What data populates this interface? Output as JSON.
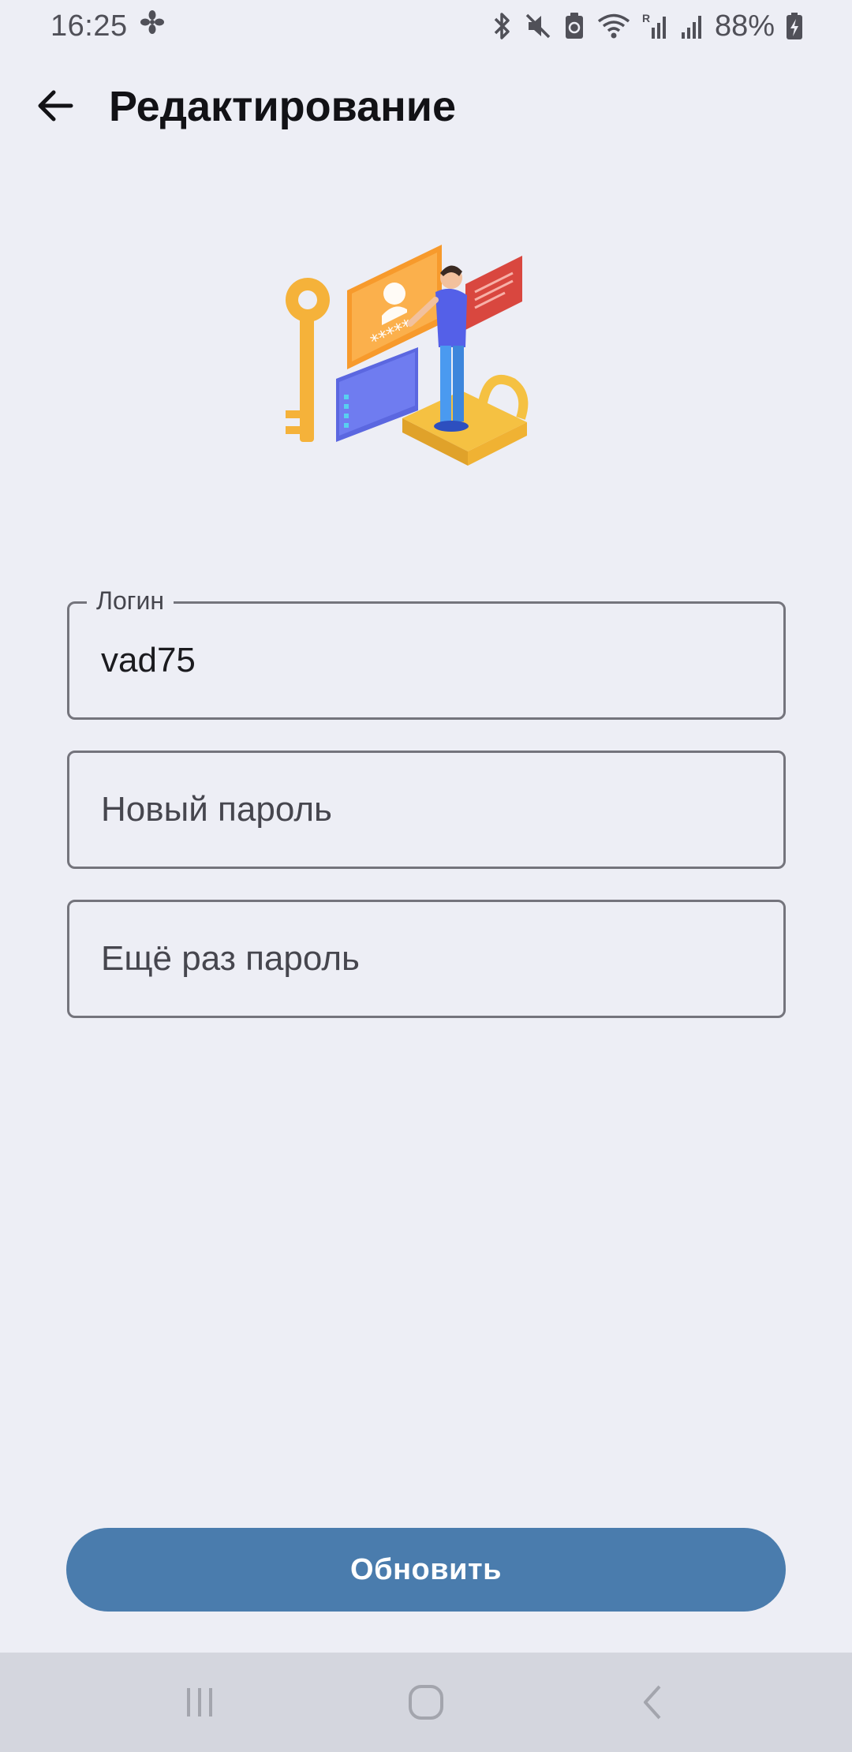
{
  "status_bar": {
    "time": "16:25",
    "battery": "88%",
    "icons": [
      "fan-icon",
      "bluetooth-icon",
      "mute-icon",
      "recycle-icon",
      "wifi-icon",
      "signal-roaming-icon",
      "signal-icon",
      "battery-charging-icon"
    ]
  },
  "app_bar": {
    "back_icon": "arrow-left-icon",
    "title": "Редактирование"
  },
  "illustration": {
    "icon": "login-security-illustration",
    "password_mask": "*****"
  },
  "form": {
    "login": {
      "label": "Логин",
      "value": "vad75"
    },
    "new_password": {
      "placeholder": "Новый пароль"
    },
    "repeat_password": {
      "placeholder": "Ещё раз пароль"
    }
  },
  "actions": {
    "update_label": "Обновить"
  },
  "nav_bar": {
    "items": [
      "recent-apps-icon",
      "home-icon",
      "back-icon"
    ]
  },
  "colors": {
    "background": "#edeef5",
    "primary": "#4a7cad",
    "field_border": "#74747c",
    "nav_bar": "#d4d6de"
  }
}
